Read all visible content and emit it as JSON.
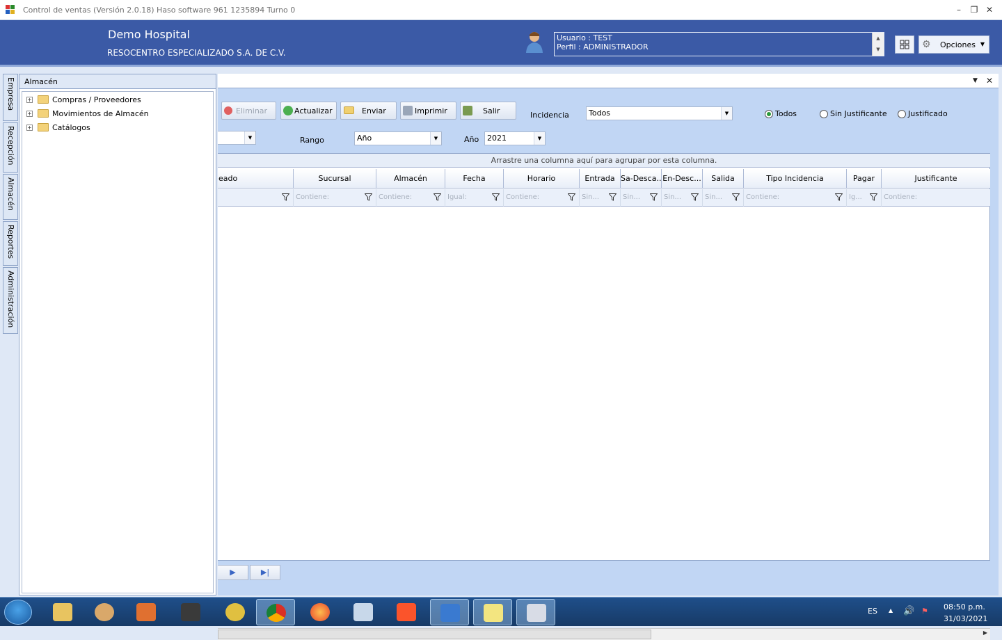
{
  "window": {
    "title": "Control de ventas  (Versión 2.0.18)  Haso software  961 1235894  Turno 0",
    "minimize": "–",
    "restore": "❐",
    "close": "✕"
  },
  "header": {
    "company": "Demo Hospital",
    "subcompany": "RESOCENTRO ESPECIALIZADO S.A. DE C.V.",
    "user_line": "Usuario : TEST",
    "profile_line": "Perfil : ADMINISTRADOR",
    "options_label": "Opciones",
    "grid_icon": "grid-icon",
    "gear_icon": "gear-icon"
  },
  "side_tabs": [
    "Empresa",
    "Recepción",
    "Almacén",
    "Reportes",
    "Administración"
  ],
  "tree": {
    "title": "Almacén",
    "nodes": [
      "Compras / Proveedores",
      "Movimientos de Almacén",
      "Catálogos"
    ]
  },
  "toolbar": {
    "delete": "Eliminar",
    "refresh": "Actualizar",
    "send": "Enviar",
    "print": "Imprimir",
    "exit": "Salir"
  },
  "filters": {
    "incidencia_label": "Incidencia",
    "incidencia_value": "Todos",
    "rango_label": "Rango",
    "rango_value": "Año",
    "anio_label": "Año",
    "anio_value": "2021",
    "radio_all": "Todos",
    "radio_unjustified": "Sin Justificante",
    "radio_justified": "Justificado",
    "selected_radio": "Todos"
  },
  "grid": {
    "group_hint": "Arrastre una columna aquí para agrupar por esta columna.",
    "columns": [
      "eado",
      "Sucursal",
      "Almacén",
      "Fecha",
      "Horario",
      "Entrada",
      "Sa-Desca...",
      "En-Desc...",
      "Salida",
      "Tipo Incidencia",
      "Pagar",
      "Justificante"
    ],
    "filter_placeholders": [
      "",
      "Contiene:",
      "Contiene:",
      "Igual:",
      "Contiene:",
      "Sin...",
      "Sin...",
      "Sin...",
      "Sin...",
      "Contiene:",
      "Ig...",
      "Contiene:"
    ]
  },
  "nav": {
    "next": "▶",
    "last": "▶|"
  },
  "taskbar": {
    "lang": "ES",
    "time": "08:50 p.m.",
    "date": "31/03/2021"
  },
  "colors": {
    "header_blue": "#3b5aa6",
    "panel_blue": "#c1d6f4",
    "accent_green": "#2a9a3a"
  }
}
